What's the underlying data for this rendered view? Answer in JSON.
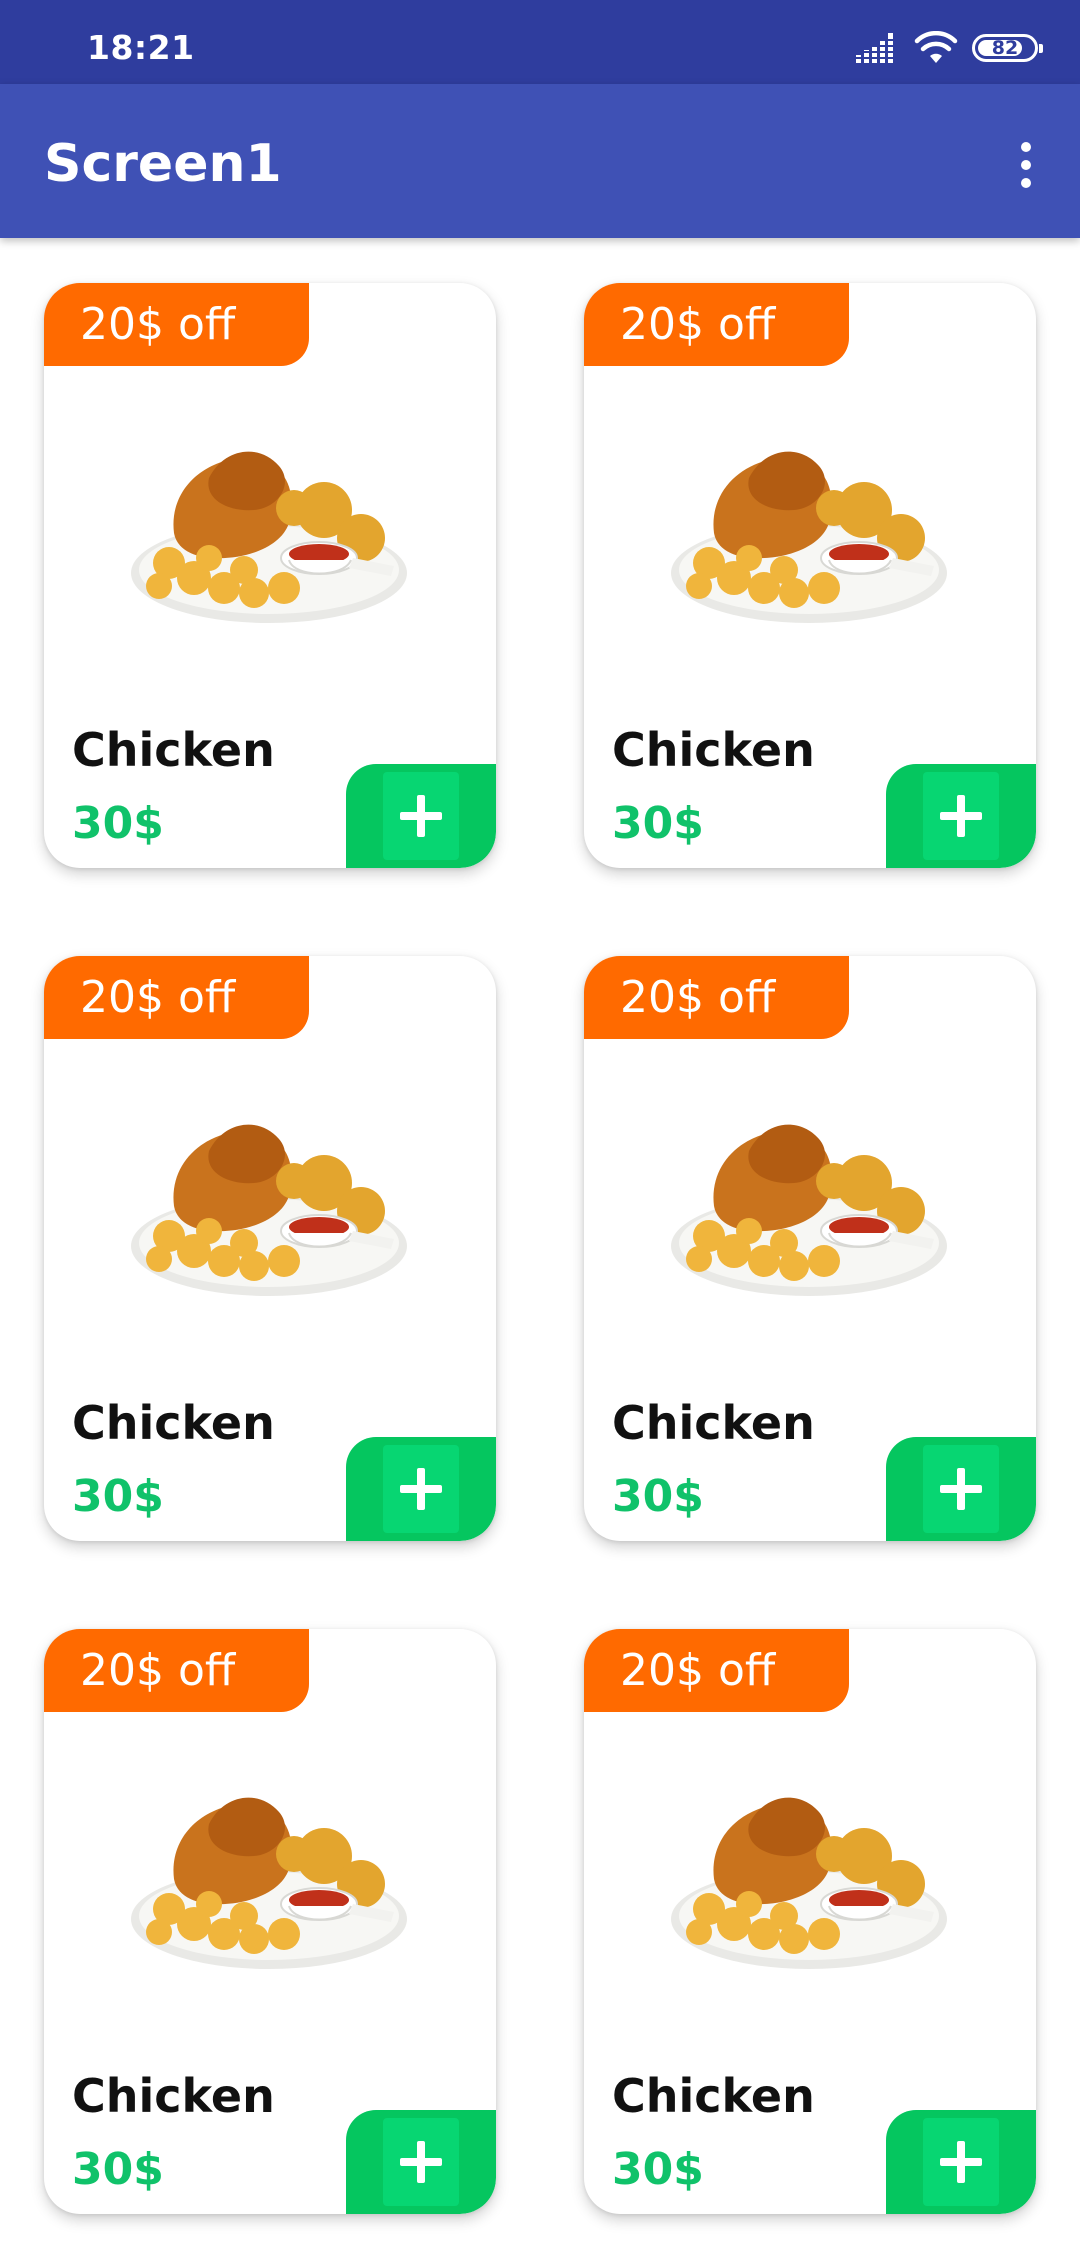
{
  "status_bar": {
    "time": "18:21",
    "battery_level": "82",
    "icons": [
      "signal-icon",
      "wifi-icon",
      "battery-icon"
    ]
  },
  "app_bar": {
    "title": "Screen1",
    "menu_icon": "more-vert-icon"
  },
  "colors": {
    "status_bar": "#2f3d9e",
    "app_bar": "#3f51b5",
    "badge": "#ff6a00",
    "price": "#10c26a",
    "add_button": "#05c65f"
  },
  "products": [
    {
      "discount": "20$ off",
      "name": "Chicken",
      "price": "30$",
      "image": "fried-chicken-plate",
      "add_icon": "plus-icon"
    },
    {
      "discount": "20$ off",
      "name": "Chicken",
      "price": "30$",
      "image": "fried-chicken-plate",
      "add_icon": "plus-icon"
    },
    {
      "discount": "20$ off",
      "name": "Chicken",
      "price": "30$",
      "image": "fried-chicken-plate",
      "add_icon": "plus-icon"
    },
    {
      "discount": "20$ off",
      "name": "Chicken",
      "price": "30$",
      "image": "fried-chicken-plate",
      "add_icon": "plus-icon"
    },
    {
      "discount": "20$ off",
      "name": "Chicken",
      "price": "30$",
      "image": "fried-chicken-plate",
      "add_icon": "plus-icon"
    },
    {
      "discount": "20$ off",
      "name": "Chicken",
      "price": "30$",
      "image": "fried-chicken-plate",
      "add_icon": "plus-icon"
    }
  ]
}
